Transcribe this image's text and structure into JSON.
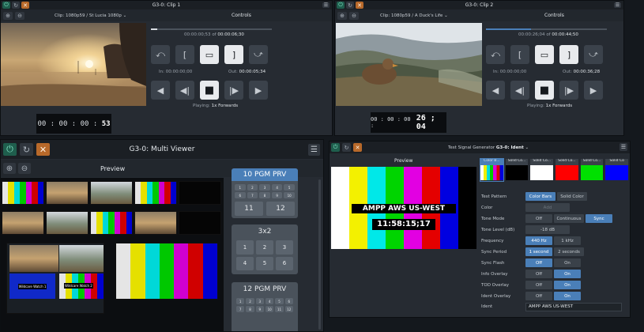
{
  "clip1": {
    "title": "G3-0: Clip 1",
    "clip_label": "Clip: 1080p59 / St Lucia 1080p",
    "controls_title": "Controls",
    "position": "00:00:00;53",
    "of": "of",
    "duration": "00:00:06;30",
    "in_label": "In:",
    "in_value": "00:00:00;00",
    "out_label": "Out:",
    "out_value": "00:00:05;34",
    "playing_label": "Playing:",
    "playing_value": "1x Forwards",
    "timecode_prefix": "00 : 00 : 00 :",
    "timecode_frames": "53",
    "progress": 0.05
  },
  "clip2": {
    "title": "G3-0: Clip 2",
    "clip_label": "Clip: 1080p59 / A Duck's Life",
    "controls_title": "Controls",
    "position": "00:00:26;04",
    "of": "of",
    "duration": "00:00:44;50",
    "in_label": "In:",
    "in_value": "00:00:00;00",
    "out_label": "Out:",
    "out_value": "00:00:36;28",
    "playing_label": "Playing:",
    "playing_value": "1x Forwards",
    "timecode_prefix": "00 : 00 : 00 :",
    "timecode_main": "26 ; 04",
    "progress": 0.37
  },
  "multiviewer": {
    "title": "G3-0: Multi Viewer",
    "preview_title": "Preview",
    "layout1": {
      "title": "10 PGM PRV",
      "small": [
        "1",
        "2",
        "3",
        "4",
        "5",
        "6",
        "7",
        "8",
        "9",
        "10"
      ],
      "big": [
        "11",
        "12"
      ]
    },
    "layout2": {
      "title": "3x2",
      "buttons": [
        "1",
        "2",
        "3",
        "4",
        "5",
        "6"
      ]
    },
    "layout3": {
      "title": "12 PGM PRV",
      "small": [
        "1",
        "2",
        "3",
        "4",
        "5",
        "6",
        "7",
        "8",
        "9",
        "10",
        "11",
        "12"
      ]
    },
    "tile_text": {
      "pgm1": "Wildcare Watch 1",
      "pgm2": "Wildcare Watch 2"
    }
  },
  "testgen": {
    "title": "Test Signal Generator",
    "title_strong": "G3-0: Ident",
    "preview_title": "Preview",
    "ident_text": "AMPP AWS US-WEST",
    "ident_time": "11:58:15;17",
    "swatches": [
      {
        "label": "Color B...",
        "color": "bars"
      },
      {
        "label": "Solid Co...",
        "color": "#000000"
      },
      {
        "label": "Solid Co...",
        "color": "#ffffff"
      },
      {
        "label": "Solid Co...",
        "color": "#ff0000"
      },
      {
        "label": "Solid Co...",
        "color": "#00e000"
      },
      {
        "label": "Solid Co",
        "color": "#0000ff"
      }
    ],
    "rows": [
      {
        "label": "Test Pattern",
        "options": [
          "Color Bars",
          "Solid Color"
        ],
        "active": 0
      },
      {
        "label": "Color",
        "options": [
          "Add"
        ],
        "active": -1
      },
      {
        "label": "Tone Mode",
        "options": [
          "Off",
          "Continuous",
          "Sync"
        ],
        "active": 2
      },
      {
        "label": "Tone Level (dB)",
        "options": [
          "-18 dB"
        ],
        "active": -1
      },
      {
        "label": "Frequency",
        "options": [
          "440 Hz",
          "1 kHz"
        ],
        "active": 0
      },
      {
        "label": "Sync Period",
        "options": [
          "1 second",
          "2 seconds"
        ],
        "active": 0
      },
      {
        "label": "Sync Flash",
        "options": [
          "Off",
          "On"
        ],
        "active": 0
      },
      {
        "label": "Info Overlay",
        "options": [
          "Off",
          "On"
        ],
        "active": 1
      },
      {
        "label": "TOD Overlay",
        "options": [
          "Off",
          "On"
        ],
        "active": 1
      },
      {
        "label": "Ident Overlay",
        "options": [
          "Off",
          "On"
        ],
        "active": 1
      }
    ],
    "ident_label": "Ident",
    "ident_value": "AMPP AWS US-WEST"
  },
  "colors": {
    "accent_blue": "#4a7fb8",
    "accent_orange": "#b8692a",
    "accent_green": "#1f5e4d",
    "panel": "#262b32"
  }
}
